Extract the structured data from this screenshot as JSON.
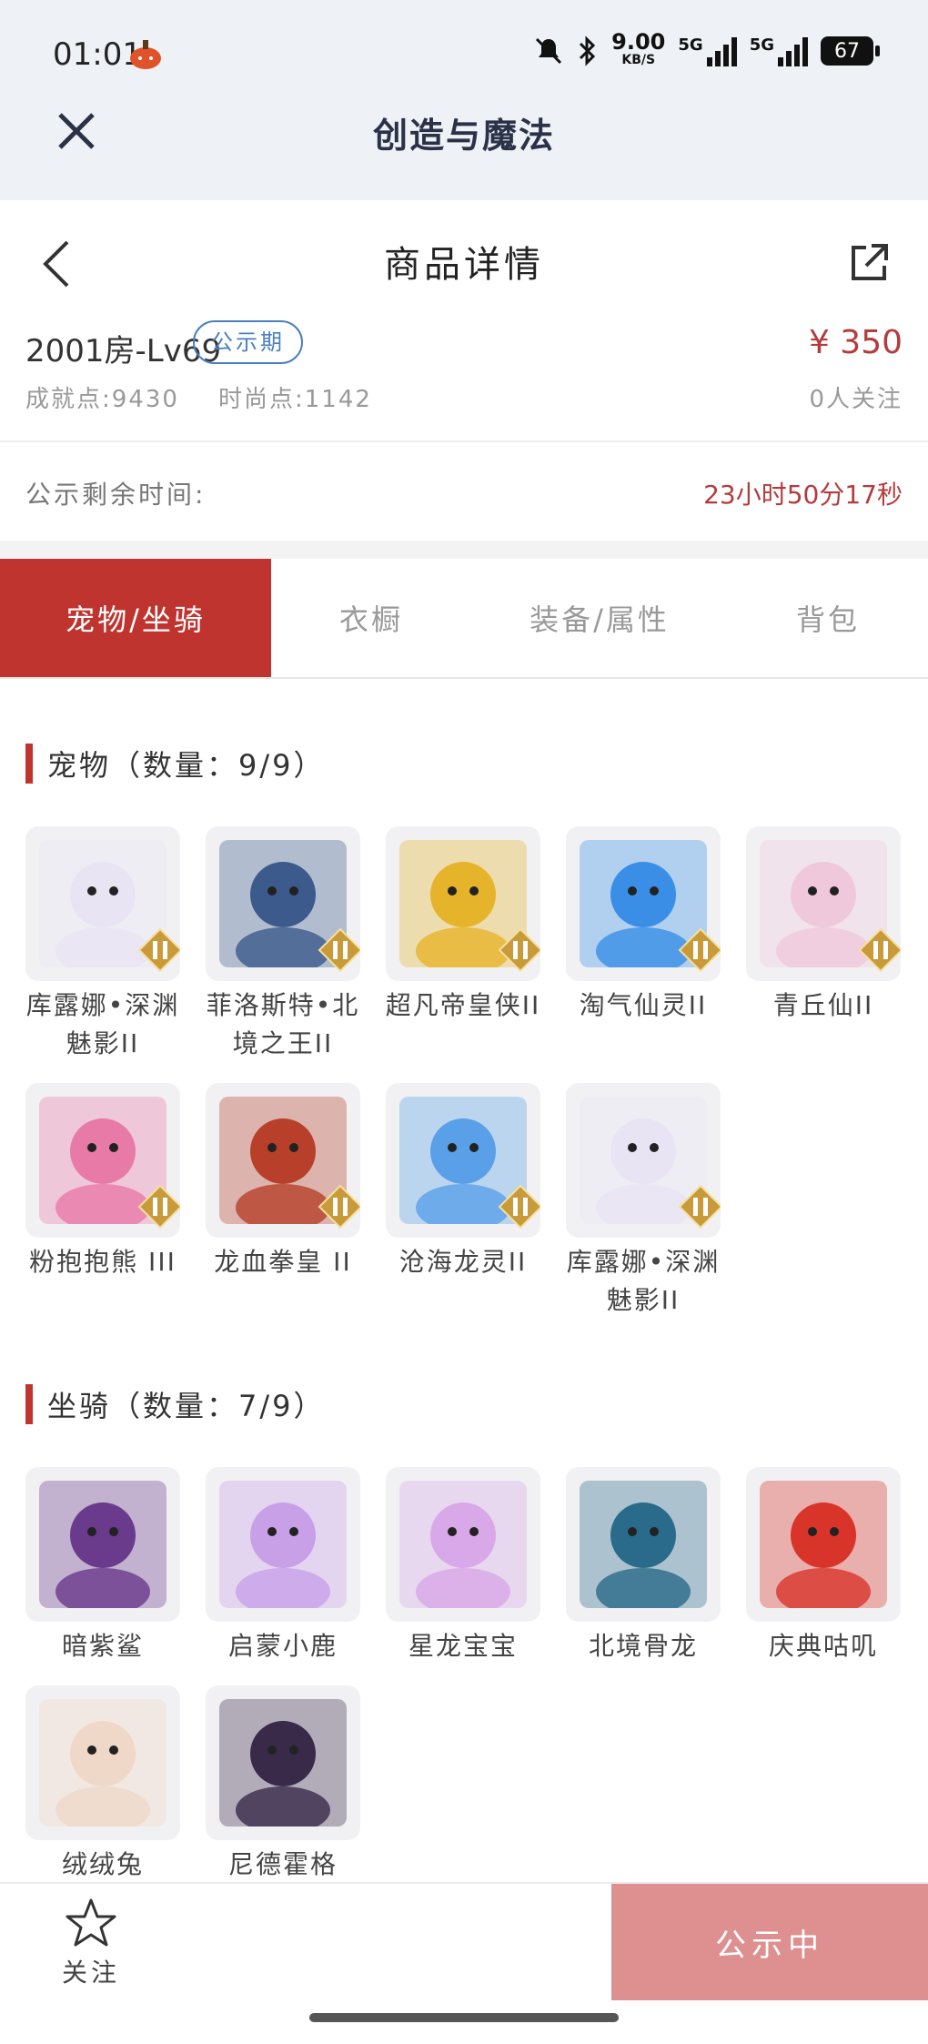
{
  "status_bar": {
    "time": "01:01",
    "speed": "9.00",
    "speed_unit": "KB/S",
    "net1": "5G",
    "net2": "5G",
    "battery": "67"
  },
  "app": {
    "title": "创造与魔法"
  },
  "header": {
    "title": "商品详情"
  },
  "product": {
    "name": "2001房-Lv69",
    "badge": "公示期",
    "price": "¥ 350",
    "achievement": "成就点:9430",
    "fashion": "时尚点:1142",
    "follows": "0人关注",
    "remain_label": "公示剩余时间:",
    "remain_value": "23小时50分17秒"
  },
  "tabs": [
    {
      "label": "宠物/坐骑",
      "active": true
    },
    {
      "label": "衣橱",
      "active": false
    },
    {
      "label": "装备/属性",
      "active": false
    },
    {
      "label": "背包",
      "active": false
    }
  ],
  "pets": {
    "title": "宠物（数量：9/9）",
    "items": [
      {
        "name": "库露娜•深渊魅影II",
        "icon": "pet-white-hair-icon",
        "color": "#e8e4f4",
        "tier": true
      },
      {
        "name": "菲洛斯特•北境之王II",
        "icon": "pet-ice-king-icon",
        "color": "#3c5a8c",
        "tier": true
      },
      {
        "name": "超凡帝皇侠II",
        "icon": "pet-gold-armor-icon",
        "color": "#e6b42a",
        "tier": true
      },
      {
        "name": "淘气仙灵II",
        "icon": "pet-blue-pup-icon",
        "color": "#3a8ee6",
        "tier": true
      },
      {
        "name": "青丘仙II",
        "icon": "pet-fox-girl-icon",
        "color": "#f0c8dc",
        "tier": true
      },
      {
        "name": "粉抱抱熊 III",
        "icon": "pet-pink-bear-icon",
        "color": "#e87aa8",
        "tier": true
      },
      {
        "name": "龙血拳皇 II",
        "icon": "pet-red-dragon-icon",
        "color": "#b8402a",
        "tier": true
      },
      {
        "name": "沧海龙灵II",
        "icon": "pet-blue-dragon-boy-icon",
        "color": "#5aa0e8",
        "tier": true
      },
      {
        "name": "库露娜•深渊魅影II",
        "icon": "pet-white-hair-icon",
        "color": "#e8e4f4",
        "tier": true
      }
    ]
  },
  "mounts": {
    "title": "坐骑（数量：7/9）",
    "items": [
      {
        "name": "暗紫鲨",
        "icon": "mount-purple-shark-icon",
        "color": "#6a3a8c"
      },
      {
        "name": "启蒙小鹿",
        "icon": "mount-white-deer-icon",
        "color": "#c8a0e8"
      },
      {
        "name": "星龙宝宝",
        "icon": "mount-star-dragon-icon",
        "color": "#d8a8e8"
      },
      {
        "name": "北境骨龙",
        "icon": "mount-bone-dragon-icon",
        "color": "#2a6a8a"
      },
      {
        "name": "庆典咕叽",
        "icon": "mount-festival-penguin-icon",
        "color": "#d8342a"
      },
      {
        "name": "绒绒兔",
        "icon": "mount-fluffy-rabbit-icon",
        "color": "#f0d8c8"
      },
      {
        "name": "尼德霍格",
        "icon": "mount-dark-dragon-icon",
        "color": "#3a2a4a"
      }
    ]
  },
  "bottom": {
    "fav_label": "关注",
    "cta_label": "公示中"
  },
  "colors": {
    "accent": "#c0342f",
    "price": "#b43c3c",
    "badge": "#4a7fc0",
    "cta": "#de8f8f"
  }
}
